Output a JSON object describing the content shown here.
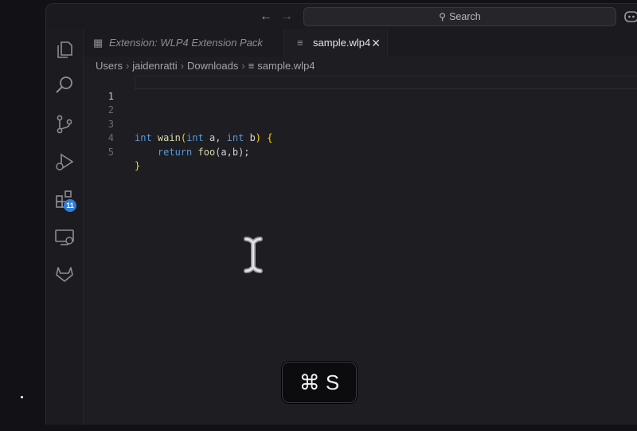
{
  "titlebar": {
    "search_placeholder": "Search",
    "back_icon": "arrow-left-icon",
    "forward_icon": "arrow-right-icon"
  },
  "activity_bar": {
    "items": [
      "explorer-icon",
      "search-icon",
      "source-control-icon",
      "run-debug-icon",
      "extensions-icon",
      "remote-explorer-icon",
      "gitlab-icon"
    ],
    "extensions_badge": "11"
  },
  "tabs": [
    {
      "label": "Extension: WLP4 Extension Pack",
      "active": false
    },
    {
      "label": "sample.wlp4",
      "active": true
    }
  ],
  "breadcrumb": [
    "Users",
    "jaidenratti",
    "Downloads",
    "sample.wlp4"
  ],
  "code": {
    "line_numbers": [
      "1",
      "2",
      "3",
      "4",
      "5"
    ],
    "lines": [
      "",
      "",
      "int wain(int a, int b) {",
      "    return foo(a,b);",
      "}"
    ],
    "tokens": {
      "l3": {
        "int1": "int",
        "wain": "wain",
        "paren_open": "(",
        "int2": "int",
        "a": " a, ",
        "int3": "int",
        "b": " b",
        "paren_close": ")",
        "space": " ",
        "brace_open": "{"
      },
      "l4": {
        "indent": "    ",
        "return": "return",
        "foo": " foo",
        "args": "(a,b);"
      },
      "l5": {
        "brace_close": "}"
      }
    }
  },
  "keycast": "⌘ S",
  "colors": {
    "keyword": "#569cd6",
    "function": "#dcdcaa",
    "bracket": "#ffd700",
    "badge": "#2f7ed8"
  }
}
